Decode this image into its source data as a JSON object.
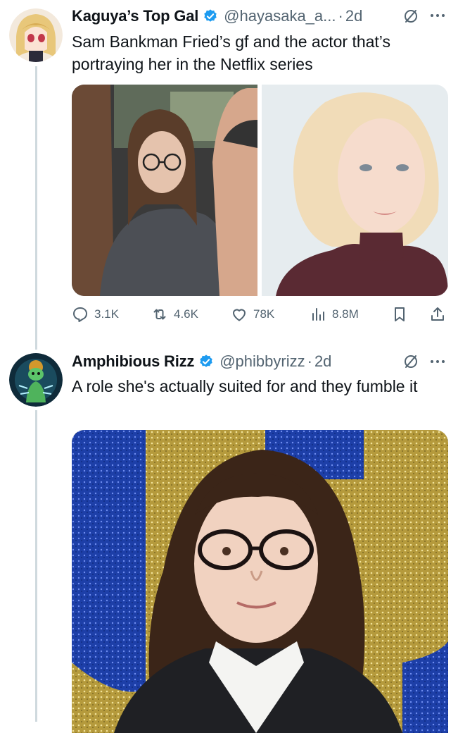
{
  "tweets": [
    {
      "display_name": "Kaguya’s Top Gal",
      "handle": "@hayasaka_a...",
      "separator": "·",
      "time": "2d",
      "text": "Sam Bankman Fried’s gf and the actor that’s portraying her in the Netflix series",
      "stats": {
        "replies": "3.1K",
        "reposts": "4.6K",
        "likes": "78K",
        "views": "8.8M"
      }
    },
    {
      "display_name": "Amphibious Rizz",
      "handle": "@phibbyrizz",
      "separator": "·",
      "time": "2d",
      "text": "A role she's actually suited for and they fumble it"
    }
  ],
  "colors": {
    "verified": "#1d9bf0",
    "muted": "#536471",
    "thread_line": "#cfd9de"
  },
  "icons": [
    "verified-badge-icon",
    "grok-icon",
    "more-icon",
    "reply-icon",
    "repost-icon",
    "like-icon",
    "views-icon",
    "bookmark-icon",
    "share-icon"
  ]
}
